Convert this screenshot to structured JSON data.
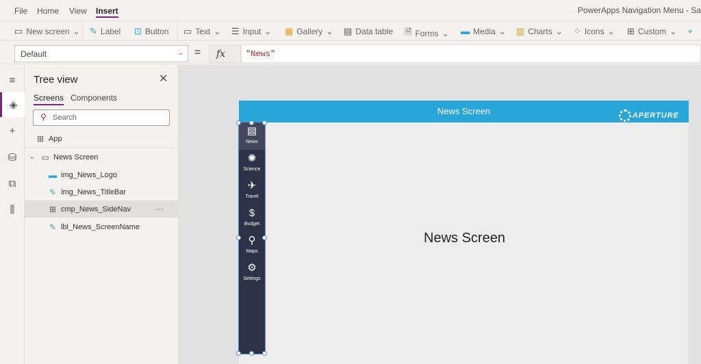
{
  "menubar": {
    "items": [
      "File",
      "Home",
      "View",
      "Insert"
    ],
    "active": "Insert",
    "app_title": "PowerApps Navigation Menu - Sa"
  },
  "toolbar": {
    "new_screen": "New screen",
    "label": "Label",
    "button": "Button",
    "text": "Text",
    "input": "Input",
    "gallery": "Gallery",
    "data_table": "Data table",
    "forms": "Forms",
    "media": "Media",
    "charts": "Charts",
    "icons": "Icons",
    "custom": "Custom"
  },
  "formula_bar": {
    "property": "Default",
    "equals": "=",
    "fx": "fx",
    "formula": "\"News\""
  },
  "tree_view": {
    "title": "Tree view",
    "tabs": [
      "Screens",
      "Components"
    ],
    "search_placeholder": "Search",
    "items": [
      {
        "label": "App",
        "icon": "app-icon"
      },
      {
        "label": "News Screen",
        "icon": "screen-icon"
      },
      {
        "label": "img_News_Logo",
        "icon": "image-icon"
      },
      {
        "label": "img_News_TitleBar",
        "icon": "edit-icon"
      },
      {
        "label": "cmp_News_SideNav",
        "icon": "component-icon",
        "selected": true,
        "more": "···"
      },
      {
        "label": "lbl_News_ScreenName",
        "icon": "edit-icon"
      }
    ]
  },
  "app": {
    "title": "News Screen",
    "logo_text": "APERTURE",
    "screen_name": "News Screen",
    "title_color": "#29a6d9",
    "nav_color": "#2f3146",
    "nav": [
      {
        "label": "News",
        "icon": "▤"
      },
      {
        "label": "Science",
        "icon": "✺"
      },
      {
        "label": "Travel",
        "icon": "✈"
      },
      {
        "label": "Budget",
        "icon": "$"
      },
      {
        "label": "Maps",
        "icon": "⚲"
      },
      {
        "label": "Settings",
        "icon": "⚙"
      }
    ]
  },
  "accent": "#742774"
}
